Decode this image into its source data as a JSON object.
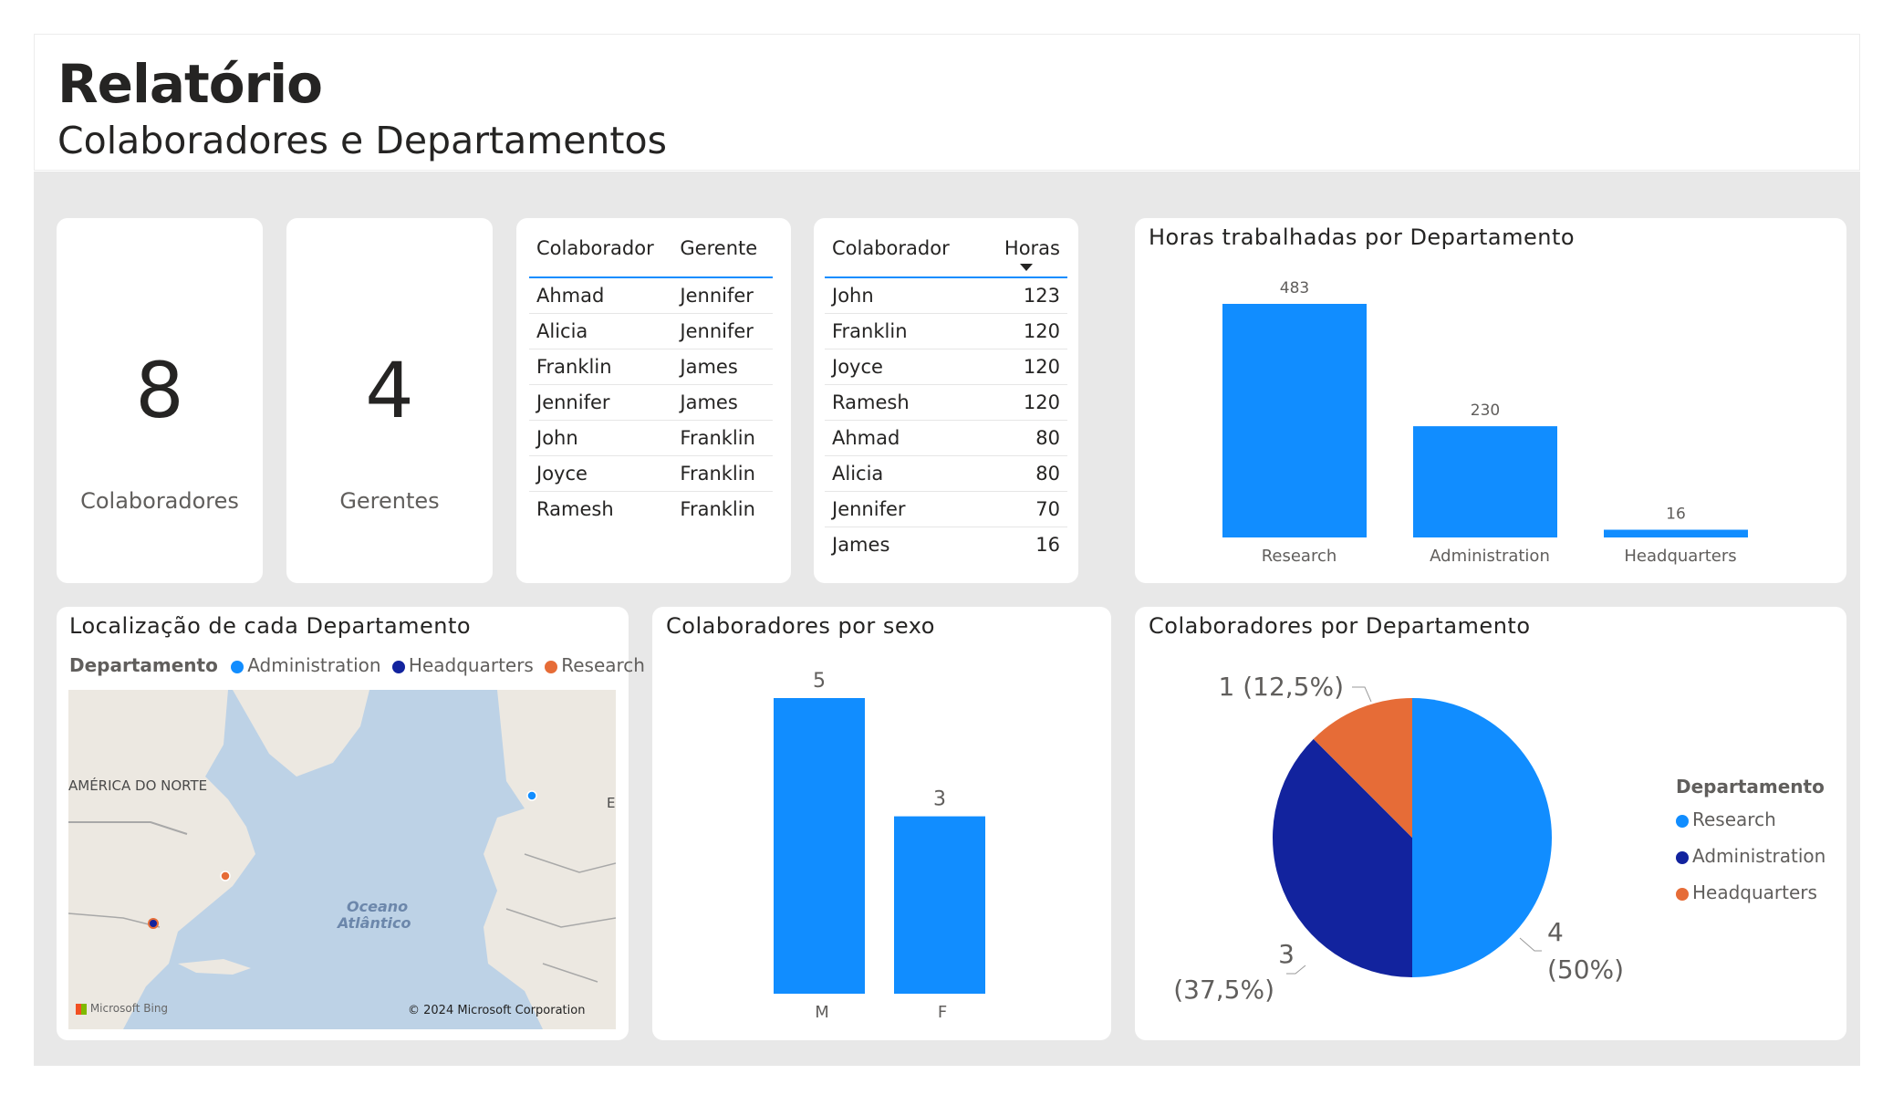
{
  "header": {
    "title": "Relatório",
    "subtitle": "Colaboradores e Departamentos"
  },
  "kpis": [
    {
      "value": "8",
      "label": "Colaboradores"
    },
    {
      "value": "4",
      "label": "Gerentes"
    }
  ],
  "table_managers": {
    "columns": [
      "Colaborador",
      "Gerente"
    ],
    "rows": [
      [
        "Ahmad",
        "Jennifer"
      ],
      [
        "Alicia",
        "Jennifer"
      ],
      [
        "Franklin",
        "James"
      ],
      [
        "Jennifer",
        "James"
      ],
      [
        "John",
        "Franklin"
      ],
      [
        "Joyce",
        "Franklin"
      ],
      [
        "Ramesh",
        "Franklin"
      ]
    ]
  },
  "table_hours": {
    "columns": [
      "Colaborador",
      "Horas"
    ],
    "rows": [
      [
        "John",
        "123"
      ],
      [
        "Franklin",
        "120"
      ],
      [
        "Joyce",
        "120"
      ],
      [
        "Ramesh",
        "120"
      ],
      [
        "Ahmad",
        "80"
      ],
      [
        "Alicia",
        "80"
      ],
      [
        "Jennifer",
        "70"
      ],
      [
        "James",
        "16"
      ]
    ]
  },
  "map": {
    "title": "Localização de cada Departamento",
    "legend_title": "Departamento",
    "legend": [
      {
        "name": "Administration",
        "color": "#118dff"
      },
      {
        "name": "Headquarters",
        "color": "#12239e"
      },
      {
        "name": "Research",
        "color": "#e66c37"
      }
    ],
    "labels": {
      "continent": "AMÉRICA DO NORTE",
      "ocean_1": "Oceano",
      "ocean_2": "Atlântico",
      "brand": "Microsoft Bing",
      "copyright": "© 2024 Microsoft Corporation",
      "edge": "E"
    }
  },
  "colors": {
    "accent": "#118dff",
    "dark": "#12239e",
    "orange": "#e66c37",
    "background": "#e8e8e8"
  },
  "chart_data": [
    {
      "type": "bar",
      "title": "Horas trabalhadas por Departamento",
      "categories": [
        "Research",
        "Administration",
        "Headquarters"
      ],
      "values": [
        483,
        230,
        16
      ],
      "color": "#118dff"
    },
    {
      "type": "bar",
      "title": "Colaboradores por sexo",
      "categories": [
        "M",
        "F"
      ],
      "values": [
        5,
        3
      ],
      "color": "#118dff"
    },
    {
      "type": "pie",
      "title": "Colaboradores por Departamento",
      "legend_title": "Departamento",
      "categories": [
        "Research",
        "Administration",
        "Headquarters"
      ],
      "values": [
        4,
        3,
        1
      ],
      "labels": [
        [
          "4",
          "(50%)"
        ],
        [
          "3",
          "(37,5%)"
        ],
        [
          "1 (12,5%)"
        ]
      ],
      "colors": [
        "#118dff",
        "#12239e",
        "#e66c37"
      ]
    }
  ]
}
